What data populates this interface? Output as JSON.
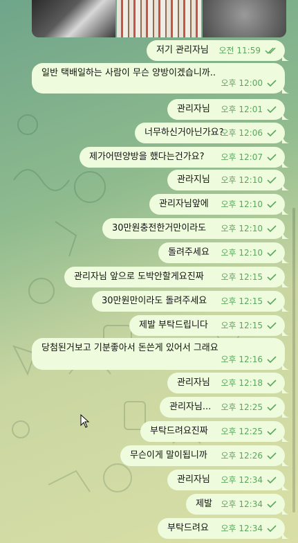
{
  "messages": [
    {
      "text": "저기 관리자님",
      "time": "오전 11:59",
      "status": "read"
    },
    {
      "text": "일반 택배일하는 사람이 무슨 양방이겠습니까..",
      "time": "오후 12:00",
      "status": "sent"
    },
    {
      "text": "관리자님",
      "time": "오후 12:01",
      "status": "sent"
    },
    {
      "text": "너무하신거아닌가요?",
      "time": "오후 12:06",
      "status": "sent"
    },
    {
      "text": "제가어떤양방을 했다는건가요?",
      "time": "오후 12:07",
      "status": "sent"
    },
    {
      "text": "관라지님",
      "time": "오후 12:10",
      "status": "sent"
    },
    {
      "text": "관리자님앞에",
      "time": "오후 12:10",
      "status": "sent"
    },
    {
      "text": "30만원충전한거만이라도",
      "time": "오후 12:10",
      "status": "sent"
    },
    {
      "text": "돌려주세요",
      "time": "오후 12:10",
      "status": "sent"
    },
    {
      "text": "관리자님 앞으로 도박안할게요진짜",
      "time": "오후 12:15",
      "status": "sent"
    },
    {
      "text": "30만원만이라도 돌려주세요",
      "time": "오후 12:15",
      "status": "sent"
    },
    {
      "text": "제발 부탁드립니다",
      "time": "오후 12:15",
      "status": "sent"
    },
    {
      "text": "당첨된거보고 기분좋아서 돈쓴게 있어서 그래요",
      "time": "오후 12:16",
      "status": "sent"
    },
    {
      "text": "관리자님",
      "time": "오후 12:18",
      "status": "sent"
    },
    {
      "text": "관리자님...",
      "time": "오후 12:25",
      "status": "sent"
    },
    {
      "text": "부탁드려요진짜",
      "time": "오후 12:25",
      "status": "sent"
    },
    {
      "text": "무슨이게 말이됩니까",
      "time": "오후 12:26",
      "status": "sent"
    },
    {
      "text": "관리자님",
      "time": "오후 12:34",
      "status": "sent"
    },
    {
      "text": "제발",
      "time": "오후 12:34",
      "status": "sent"
    },
    {
      "text": "부탁드려요",
      "time": "오후 12:34",
      "status": "sent"
    }
  ],
  "colors": {
    "bubble": "#eefbdc",
    "meta": "#5ba65e"
  }
}
